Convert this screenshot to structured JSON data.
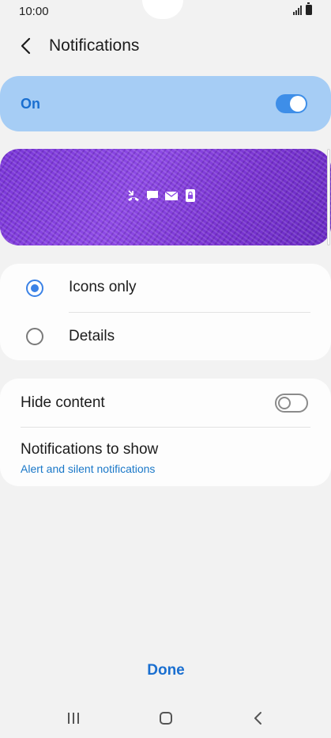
{
  "status_bar": {
    "time": "10:00",
    "icons": [
      "signal-icon",
      "battery-icon"
    ]
  },
  "header": {
    "title": "Notifications",
    "back_icon": "back-arrow-icon"
  },
  "master_toggle": {
    "label": "On",
    "checked": true
  },
  "preview": {
    "icons": [
      "missed-call-icon",
      "message-icon",
      "email-icon",
      "lock-icon"
    ]
  },
  "display_style": {
    "options": [
      {
        "label": "Icons only",
        "selected": true
      },
      {
        "label": "Details",
        "selected": false
      }
    ]
  },
  "settings": {
    "hide_content": {
      "label": "Hide content",
      "checked": false
    },
    "notifications_to_show": {
      "label": "Notifications to show",
      "value": "Alert and silent notifications"
    }
  },
  "footer": {
    "done_label": "Done"
  },
  "nav_bar": {
    "buttons": [
      "recent-apps-icon",
      "home-icon",
      "back-icon"
    ]
  },
  "colors": {
    "accent": "#3e8ee8",
    "highlight_bar": "#a6cdf5",
    "link": "#1a78c8",
    "background": "#f2f2f2"
  }
}
